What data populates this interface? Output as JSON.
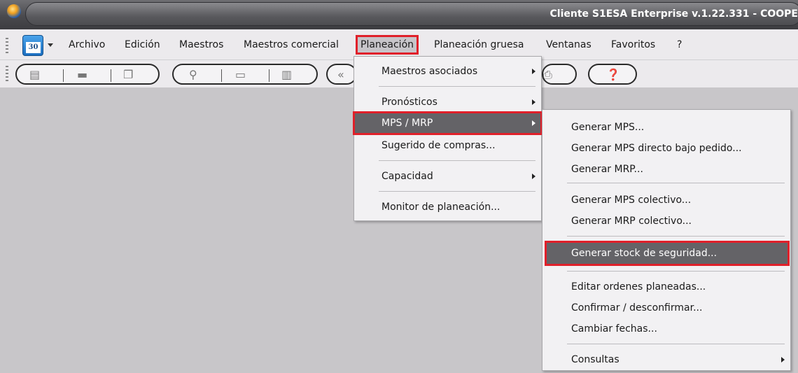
{
  "window": {
    "title": "Cliente S1ESA Enterprise v.1.22.331 - COOPE"
  },
  "menubar": {
    "calendar_day": "30",
    "items": [
      {
        "label": "Archivo"
      },
      {
        "label": "Edición"
      },
      {
        "label": "Maestros"
      },
      {
        "label": "Maestros comercial"
      },
      {
        "label": "Planeación"
      },
      {
        "label": "Planeación gruesa"
      },
      {
        "label": "Ventanas"
      },
      {
        "label": "Favoritos"
      },
      {
        "label": "?"
      }
    ]
  },
  "toolbar": {
    "icons": [
      "new-document-icon",
      "open-folder-icon",
      "copy-icon",
      "search-icon",
      "save-icon",
      "delete-icon",
      "back-icon",
      "print-icon",
      "help-icon"
    ]
  },
  "planeacion_menu": {
    "items": [
      {
        "label": "Maestros asociados",
        "has_submenu": true
      },
      {
        "label": "Pronósticos",
        "has_submenu": true
      },
      {
        "label": "MPS / MRP",
        "has_submenu": true,
        "selected": true
      },
      {
        "label": "Sugerido de compras...",
        "has_submenu": false
      },
      {
        "label": "Capacidad",
        "has_submenu": true
      },
      {
        "label": "Monitor de planeación...",
        "has_submenu": false
      }
    ]
  },
  "mps_mrp_submenu": {
    "items": [
      {
        "label": "Generar MPS..."
      },
      {
        "label": "Generar MPS directo bajo pedido..."
      },
      {
        "label": "Generar MRP..."
      },
      {
        "label": "Generar MPS colectivo..."
      },
      {
        "label": "Generar MRP colectivo..."
      },
      {
        "label": "Generar stock de seguridad...",
        "selected": true
      },
      {
        "label": "Editar ordenes planeadas..."
      },
      {
        "label": "Confirmar / desconfirmar..."
      },
      {
        "label": "Cambiar fechas..."
      },
      {
        "label": "Consultas",
        "has_submenu": true
      }
    ]
  },
  "colors": {
    "highlight_outline": "#e0202a",
    "selected_bg": "#646367",
    "titlebar": "#4a4a4e"
  }
}
